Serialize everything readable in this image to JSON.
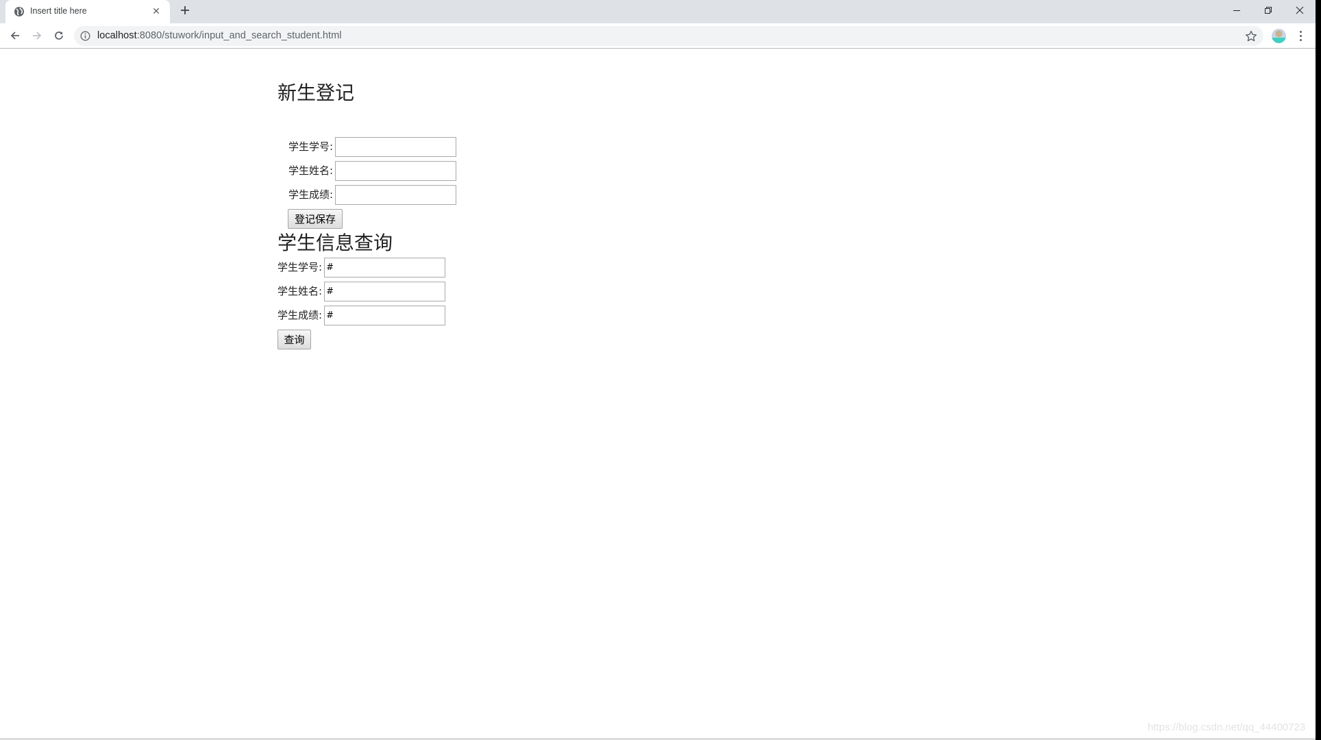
{
  "browser": {
    "tab": {
      "title": "Insert title here",
      "favicon": "globe-icon",
      "close_icon": "close-icon"
    },
    "new_tab_icon": "plus-icon",
    "window_controls": [
      "minimize-icon",
      "restore-icon",
      "close-icon"
    ],
    "nav": [
      "back-arrow-icon",
      "forward-arrow-icon",
      "reload-icon"
    ],
    "address_bar": {
      "host": "localhost",
      "rest": ":8080/stuwork/input_and_search_student.html",
      "security_icon": "info-icon",
      "bookmark_icon": "star-icon"
    },
    "profile_icon": "avatar",
    "menu_icon": "kebab-menu-icon"
  },
  "register_section": {
    "heading": "新生登记",
    "fields": [
      {
        "label": "学生学号:",
        "value": ""
      },
      {
        "label": "学生姓名:",
        "value": ""
      },
      {
        "label": "学生成绩:",
        "value": ""
      }
    ],
    "submit_label": "登记保存"
  },
  "search_section": {
    "heading": "学生信息查询",
    "fields": [
      {
        "label": "学生学号:",
        "value": "#"
      },
      {
        "label": "学生姓名:",
        "value": "#"
      },
      {
        "label": "学生成绩:",
        "value": "#"
      }
    ],
    "submit_label": "查询"
  },
  "watermark": "https://blog.csdn.net/qq_44400723"
}
